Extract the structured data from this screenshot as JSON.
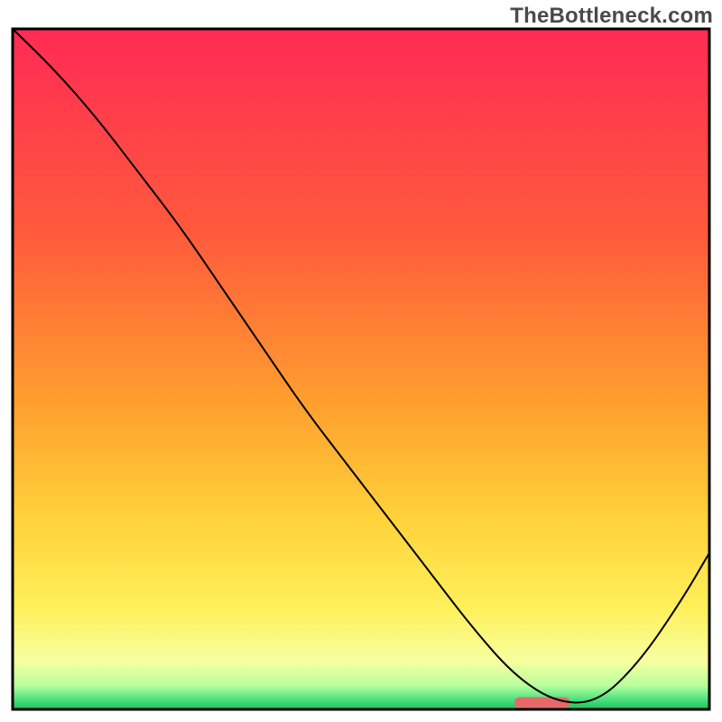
{
  "watermark": "TheBottleneck.com",
  "chart_data": {
    "type": "line",
    "title": "",
    "xlabel": "",
    "ylabel": "",
    "xlim": [
      0,
      100
    ],
    "ylim": [
      0,
      100
    ],
    "grid": false,
    "legend": null,
    "series": [
      {
        "name": "bottleneck-curve",
        "x": [
          0,
          6,
          12,
          18,
          24,
          30,
          36,
          42,
          48,
          54,
          60,
          66,
          72,
          78,
          84,
          90,
          96,
          100
        ],
        "y": [
          100,
          94,
          87,
          79,
          71,
          62,
          53,
          44,
          36,
          28,
          20,
          12,
          5,
          1,
          1,
          7,
          16,
          23
        ],
        "stroke": "#000000",
        "stroke_width": 2
      }
    ],
    "optimal_marker": {
      "x_start": 72,
      "x_end": 80,
      "y": 1,
      "color": "#e46a6a"
    },
    "background_gradient_stops": [
      {
        "offset": 0.0,
        "color": "#ff2a55"
      },
      {
        "offset": 0.3,
        "color": "#ff5a3c"
      },
      {
        "offset": 0.55,
        "color": "#ff9f2e"
      },
      {
        "offset": 0.72,
        "color": "#ffd23a"
      },
      {
        "offset": 0.85,
        "color": "#fff05a"
      },
      {
        "offset": 0.93,
        "color": "#f7ffa0"
      },
      {
        "offset": 0.965,
        "color": "#b8ff9e"
      },
      {
        "offset": 0.985,
        "color": "#4ee27e"
      },
      {
        "offset": 1.0,
        "color": "#1dbf5a"
      }
    ]
  },
  "frame": {
    "color": "#000000",
    "width": 3
  }
}
